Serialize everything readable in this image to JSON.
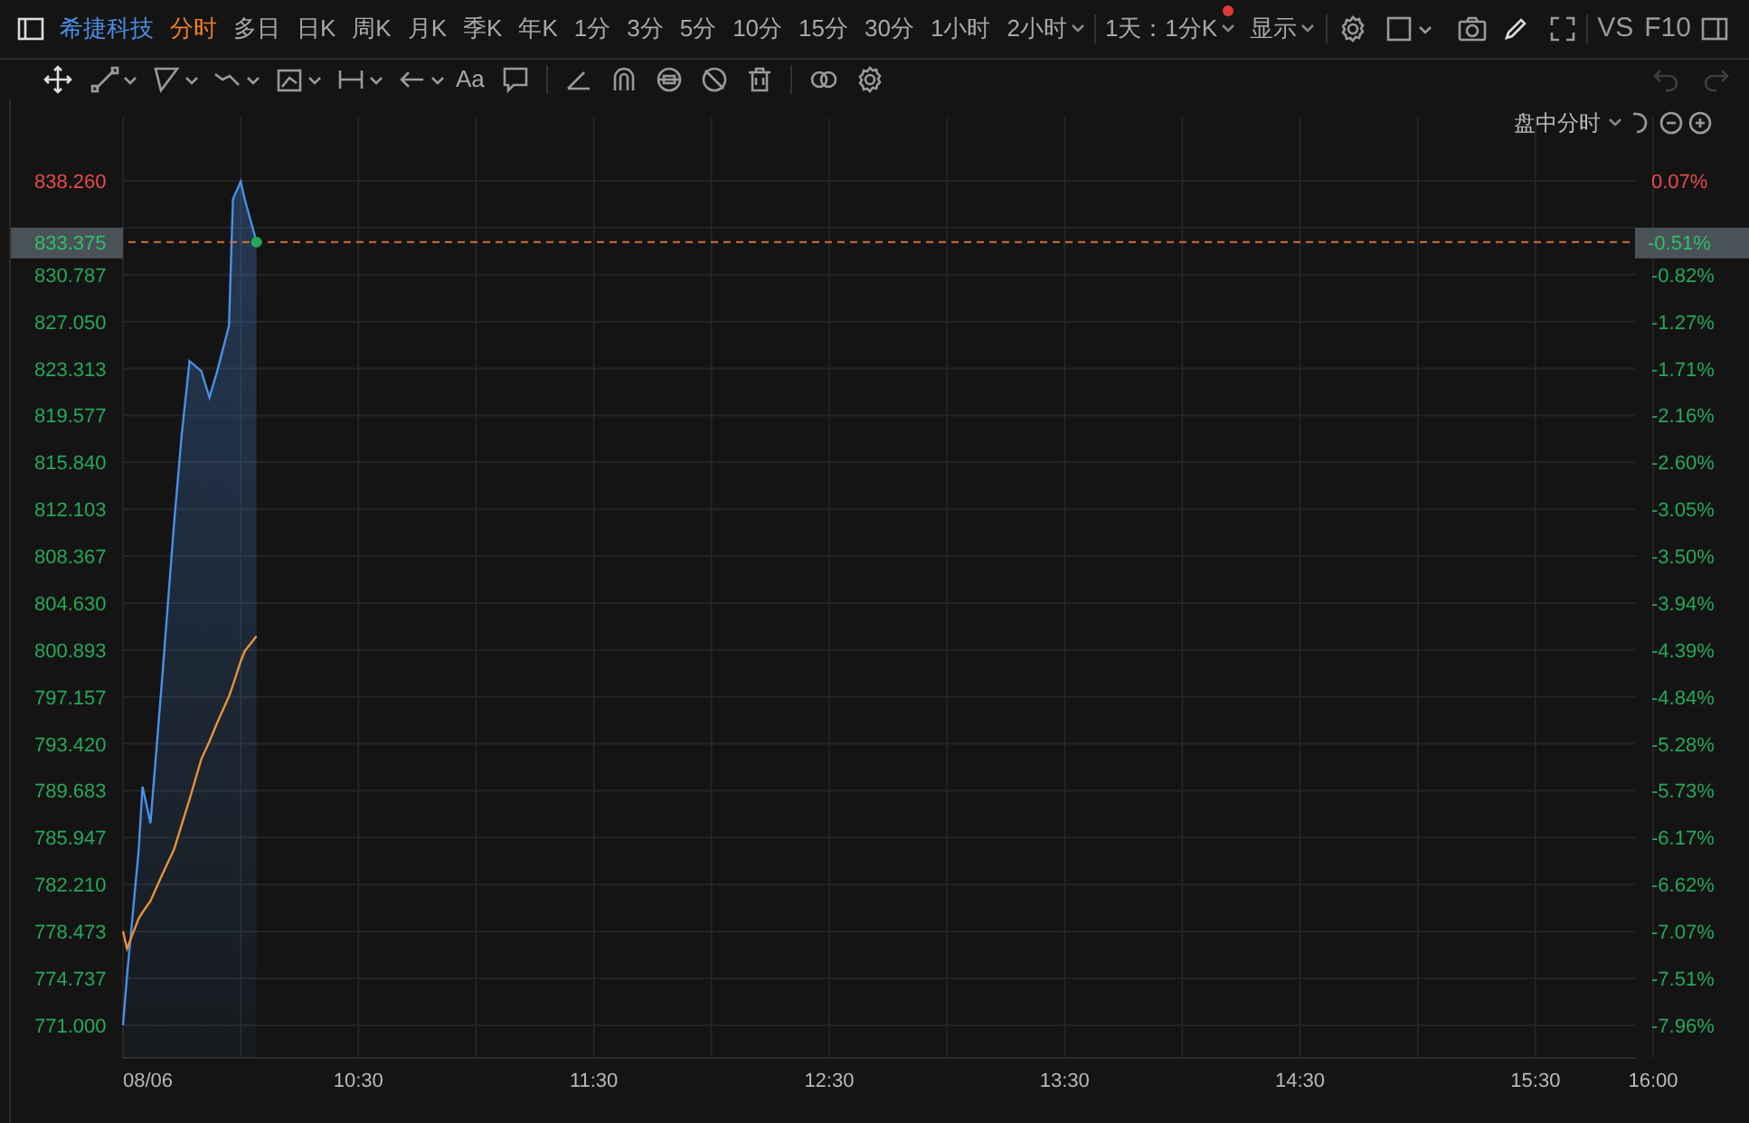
{
  "toolbar": {
    "stock": "希捷科技",
    "periods": [
      {
        "label": "分时",
        "selected": true
      },
      {
        "label": "多日",
        "selected": false
      },
      {
        "label": "日K",
        "selected": false
      },
      {
        "label": "周K",
        "selected": false
      },
      {
        "label": "月K",
        "selected": false
      },
      {
        "label": "季K",
        "selected": false
      },
      {
        "label": "年K",
        "selected": false
      },
      {
        "label": "1分",
        "selected": false
      },
      {
        "label": "3分",
        "selected": false
      },
      {
        "label": "5分",
        "selected": false
      },
      {
        "label": "10分",
        "selected": false
      },
      {
        "label": "15分",
        "selected": false
      },
      {
        "label": "30分",
        "selected": false
      },
      {
        "label": "1小时",
        "selected": false
      },
      {
        "label": "2小时",
        "selected": false
      }
    ],
    "range": "1天：1分K",
    "display": "显示",
    "vs": "VS",
    "f10": "F10"
  },
  "drawing_tools": {
    "text_tool": "Aa",
    "history": [
      {
        "kind": "undo",
        "disabled": true
      },
      {
        "kind": "redo",
        "disabled": true
      }
    ]
  },
  "chart": {
    "mode": "盘中分时",
    "date_label": "08/06",
    "chart_data": {
      "type": "line",
      "grid": true,
      "ref_lines": [
        {
          "axis": "y",
          "value": 833.375,
          "color": "#d0703a"
        }
      ],
      "x": [
        9.5,
        9.517,
        9.567,
        9.583,
        9.617,
        9.667,
        9.717,
        9.75,
        9.783,
        9.833,
        9.867,
        9.9,
        9.95,
        9.967,
        10.0,
        10.017,
        10.067
      ],
      "series": [
        {
          "color": "#4a8fe7",
          "values": [
            771.0,
            774.9,
            785.0,
            790.0,
            787.1,
            798.7,
            810.9,
            818.1,
            823.9,
            823.1,
            821.0,
            823.1,
            826.7,
            836.8,
            838.2,
            836.8,
            833.4
          ]
        },
        {
          "color": "#e8923a",
          "values": [
            778.5,
            777.1,
            779.5,
            780.0,
            780.9,
            783.0,
            785.0,
            787.0,
            789.0,
            792.2,
            793.6,
            795.1,
            797.2,
            798.1,
            800.0,
            800.8,
            802.0
          ]
        }
      ],
      "xlim": [
        9.5,
        16
      ],
      "ylim": [
        768.4,
        843.3
      ],
      "xticks": [
        {
          "value": 10.5,
          "label": "10:30"
        },
        {
          "value": 11.5,
          "label": "11:30"
        },
        {
          "value": 12.5,
          "label": "12:30"
        },
        {
          "value": 13.5,
          "label": "13:30"
        },
        {
          "value": 14.5,
          "label": "14:30"
        },
        {
          "value": 15.5,
          "label": "15:30"
        },
        {
          "value": 16,
          "label": "16:00"
        }
      ],
      "yticks": [
        {
          "value": 838.26,
          "label": "838.260"
        },
        {
          "value": 830.787,
          "label": "830.787"
        },
        {
          "value": 827.05,
          "label": "827.050"
        },
        {
          "value": 823.313,
          "label": "823.313"
        },
        {
          "value": 819.577,
          "label": "819.577"
        },
        {
          "value": 815.84,
          "label": "815.840"
        },
        {
          "value": 812.103,
          "label": "812.103"
        },
        {
          "value": 808.367,
          "label": "808.367"
        },
        {
          "value": 804.63,
          "label": "804.630"
        },
        {
          "value": 800.893,
          "label": "800.893"
        },
        {
          "value": 797.157,
          "label": "797.157"
        },
        {
          "value": 793.42,
          "label": "793.420"
        },
        {
          "value": 789.683,
          "label": "789.683"
        },
        {
          "value": 785.947,
          "label": "785.947"
        },
        {
          "value": 782.21,
          "label": "782.210"
        },
        {
          "value": 778.473,
          "label": "778.473"
        },
        {
          "value": 774.737,
          "label": "774.737"
        },
        {
          "value": 771.0,
          "label": "771.000"
        }
      ]
    },
    "current_price": {
      "price": "833.375",
      "percent": "-0.51%"
    },
    "percent_labels": [
      {
        "text": "0.07%",
        "color": "#e84b4b"
      },
      {
        "text": "-0.82%",
        "color": "#25a85a"
      },
      {
        "text": "-1.27%",
        "color": "#25a85a"
      },
      {
        "text": "-1.71%",
        "color": "#25a85a"
      },
      {
        "text": "-2.16%",
        "color": "#25a85a"
      },
      {
        "text": "-2.60%",
        "color": "#25a85a"
      },
      {
        "text": "-3.05%",
        "color": "#25a85a"
      },
      {
        "text": "-3.50%",
        "color": "#25a85a"
      },
      {
        "text": "-3.94%",
        "color": "#25a85a"
      },
      {
        "text": "-4.39%",
        "color": "#25a85a"
      },
      {
        "text": "-4.84%",
        "color": "#25a85a"
      },
      {
        "text": "-5.28%",
        "color": "#25a85a"
      },
      {
        "text": "-5.73%",
        "color": "#25a85a"
      },
      {
        "text": "-6.17%",
        "color": "#25a85a"
      },
      {
        "text": "-6.62%",
        "color": "#25a85a"
      },
      {
        "text": "-7.07%",
        "color": "#25a85a"
      },
      {
        "text": "-7.51%",
        "color": "#25a85a"
      },
      {
        "text": "-7.96%",
        "color": "#25a85a"
      }
    ]
  }
}
